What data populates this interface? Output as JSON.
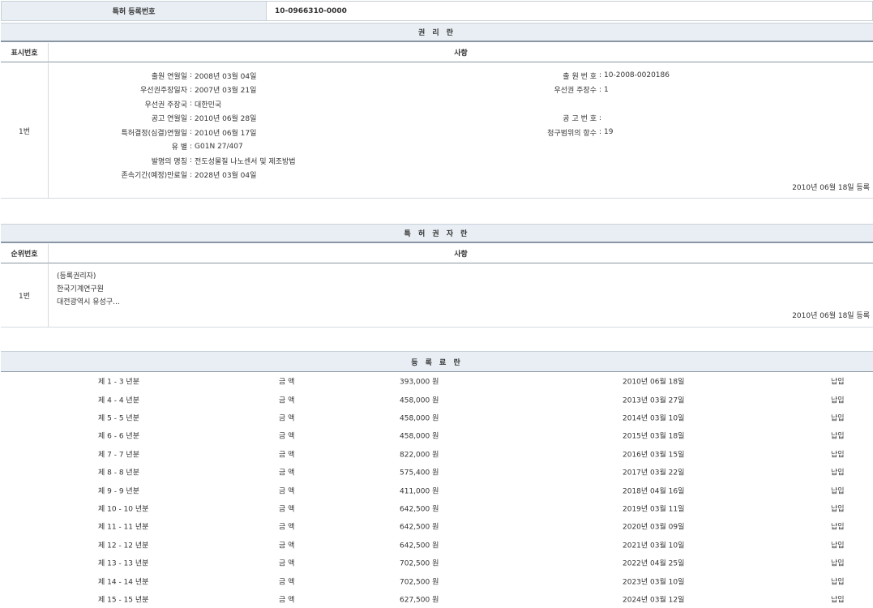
{
  "registration": {
    "label": "특허 등록번호",
    "value": "10-0966310-0000"
  },
  "rights_section": {
    "title": "권 리 란",
    "col1": "표시번호",
    "col2": "사항",
    "row_index": "1번",
    "left_fields": [
      {
        "label": "출원 연월일",
        "value": "2008년 03월 04일"
      },
      {
        "label": "우선권주장일자",
        "value": "2007년 03월 21일"
      },
      {
        "label": "우선권 주장국",
        "value": "대한민국"
      },
      {
        "label": "공고 연월일",
        "value": "2010년 06월 28일"
      },
      {
        "label": "특허결정(심결)연월일",
        "value": "2010년 06월 17일"
      },
      {
        "label": "유 별",
        "value": "G01N 27/407"
      },
      {
        "label": "발명의 명칭",
        "value": "전도성물질 나노센서 및 제조방법"
      },
      {
        "label": "존속기간(예정)만료일",
        "value": "2028년 03월 04일"
      }
    ],
    "right_fields": [
      {
        "label": "출 원 번 호",
        "value": "10-2008-0020186"
      },
      {
        "label": "우선권 주장수",
        "value": "1"
      },
      {
        "label": "",
        "value": ""
      },
      {
        "label": "공 고 번 호",
        "value": ""
      },
      {
        "label": "청구범위의 항수",
        "value": "19"
      }
    ],
    "reg_date": "2010년 06월 18일 등록"
  },
  "holder_section": {
    "title": "특 허 권 자 란",
    "col1": "순위번호",
    "col2": "사항",
    "row_index": "1번",
    "lines": [
      "(등록권리자)",
      "한국기계연구원",
      "대전광역시 유성구..."
    ],
    "reg_date": "2010년 06월 18일 등록"
  },
  "fee_section": {
    "title": "등 록 료 란",
    "rows": [
      {
        "period": "제 1 - 3 년분",
        "label": "금 액",
        "amount": "393,000 원",
        "date": "2010년 06월 18일",
        "status": "납입"
      },
      {
        "period": "제 4 - 4 년분",
        "label": "금 액",
        "amount": "458,000 원",
        "date": "2013년 03월 27일",
        "status": "납입"
      },
      {
        "period": "제 5 - 5 년분",
        "label": "금 액",
        "amount": "458,000 원",
        "date": "2014년 03월 10일",
        "status": "납입"
      },
      {
        "period": "제 6 - 6 년분",
        "label": "금 액",
        "amount": "458,000 원",
        "date": "2015년 03월 18일",
        "status": "납입"
      },
      {
        "period": "제 7 - 7 년분",
        "label": "금 액",
        "amount": "822,000 원",
        "date": "2016년 03월 15일",
        "status": "납입"
      },
      {
        "period": "제 8 - 8 년분",
        "label": "금 액",
        "amount": "575,400 원",
        "date": "2017년 03월 22일",
        "status": "납입"
      },
      {
        "period": "제 9 - 9 년분",
        "label": "금 액",
        "amount": "411,000 원",
        "date": "2018년 04월 16일",
        "status": "납입"
      },
      {
        "period": "제 10 - 10 년분",
        "label": "금 액",
        "amount": "642,500 원",
        "date": "2019년 03월 11일",
        "status": "납입"
      },
      {
        "period": "제 11 - 11 년분",
        "label": "금 액",
        "amount": "642,500 원",
        "date": "2020년 03월 09일",
        "status": "납입"
      },
      {
        "period": "제 12 - 12 년분",
        "label": "금 액",
        "amount": "642,500 원",
        "date": "2021년 03월 10일",
        "status": "납입"
      },
      {
        "period": "제 13 - 13 년분",
        "label": "금 액",
        "amount": "702,500 원",
        "date": "2022년 04월 25일",
        "status": "납입"
      },
      {
        "period": "제 14 - 14 년분",
        "label": "금 액",
        "amount": "702,500 원",
        "date": "2023년 03월 10일",
        "status": "납입"
      },
      {
        "period": "제 15 - 15 년분",
        "label": "금 액",
        "amount": "627,500 원",
        "date": "2024년 03월 12일",
        "status": "납입"
      }
    ]
  }
}
